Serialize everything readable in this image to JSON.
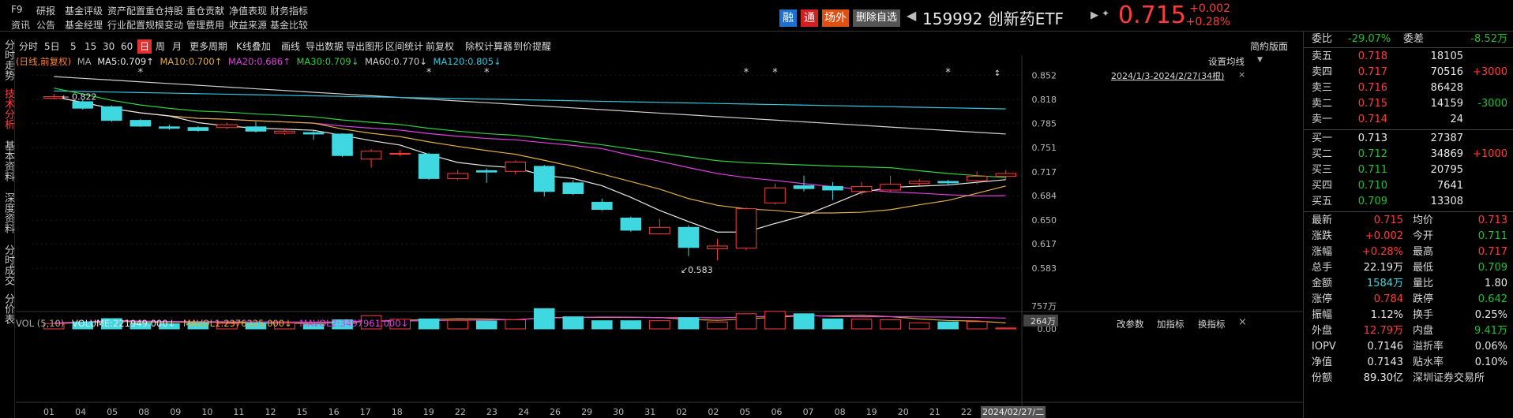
{
  "menu": {
    "code_key": "F9",
    "row1": [
      "研报",
      "基金评级",
      "资产配置",
      "重仓持股",
      "重仓贡献",
      "净值表现",
      "财务指标"
    ],
    "row2": [
      "资讯",
      "公告",
      "基金经理",
      "行业配置",
      "规模变动",
      "管理费用",
      "收益来源",
      "基金比较"
    ]
  },
  "header": {
    "btn_rong": "融",
    "btn_tong": "通",
    "btn_changwai": "场外",
    "btn_delete": "删除自选",
    "title": "159992 创新药ETF",
    "price": "0.715",
    "change": "+0.002",
    "change_pct": "+0.28%"
  },
  "left_tabs": [
    "分时走势",
    "技术分析",
    "基本资料",
    "深度资料",
    "分时成交",
    "分价表"
  ],
  "toolbar": {
    "items": [
      "分时",
      "5日",
      "5",
      "15",
      "30",
      "60",
      "日",
      "周",
      "月",
      "更多周期",
      "K线叠加",
      "画线",
      "导出数据",
      "导出图形",
      "区间统计",
      "前复权",
      "除权计算器",
      "到价提醒"
    ],
    "active": "日",
    "right_label": "简約版面"
  },
  "ma_row": {
    "prefix": "(日线,前复权)",
    "ma_label": "MA",
    "ma5": "MA5:0.709↑",
    "ma10": "MA10:0.700↑",
    "ma20": "MA20:0.686↑",
    "ma30": "MA30:0.709↓",
    "ma60": "MA60:0.770↓",
    "ma120": "MA120:0.805↓"
  },
  "chart_meta": {
    "set_ma": "设置均线",
    "range_label": "2024/1/3-2024/2/27(34根)",
    "high_label": "0.822",
    "low_label": "0.583"
  },
  "vol_row": {
    "label": "VOL (5,10)",
    "volume": "VOLUME:221949.000↓",
    "mavol1": "MAVOL1:2376325.000↓",
    "mavol2": "MAVOL2:3497961.000↓",
    "btn_params": "改参数",
    "btn_add": "加指标",
    "btn_switch": "换指标"
  },
  "colors": {
    "up": "#ff3b3b",
    "down": "#3fd8e0",
    "ma5": "#e8e8e8",
    "ma10": "#e0b040",
    "ma20": "#e040e0",
    "ma30": "#30d040",
    "ma60": "#d0d0d0",
    "ma120": "#30c8e0"
  },
  "chart_data": {
    "type": "candlestick",
    "price_ticks": [
      "0.852",
      "0.818",
      "0.785",
      "0.751",
      "0.717",
      "0.684",
      "0.650",
      "0.617",
      "0.583"
    ],
    "ylim": [
      0.57,
      0.86
    ],
    "vol_ticks": [
      "757万",
      "264万",
      "0.00"
    ],
    "vol_ylim": [
      0,
      757
    ],
    "vol_current_label": "264万",
    "x_labels": [
      "01",
      "04",
      "05",
      "08",
      "09",
      "10",
      "11",
      "12",
      "15",
      "16",
      "17",
      "18",
      "19",
      "22",
      "23",
      "24",
      "26",
      "29",
      "30",
      "31",
      "02",
      "02",
      "05",
      "06",
      "07",
      "08",
      "19",
      "20",
      "21",
      "22",
      "2"
    ],
    "date_cursor": "2024/02/27/二",
    "candles": [
      {
        "o": 0.82,
        "c": 0.822,
        "h": 0.826,
        "l": 0.818,
        "v": 180
      },
      {
        "o": 0.815,
        "c": 0.806,
        "h": 0.818,
        "l": 0.804,
        "v": 230
      },
      {
        "o": 0.808,
        "c": 0.789,
        "h": 0.81,
        "l": 0.787,
        "v": 340
      },
      {
        "o": 0.789,
        "c": 0.781,
        "h": 0.791,
        "l": 0.78,
        "v": 190
      },
      {
        "o": 0.78,
        "c": 0.778,
        "h": 0.783,
        "l": 0.776,
        "v": 170
      },
      {
        "o": 0.779,
        "c": 0.775,
        "h": 0.781,
        "l": 0.773,
        "v": 200
      },
      {
        "o": 0.779,
        "c": 0.783,
        "h": 0.786,
        "l": 0.777,
        "v": 180
      },
      {
        "o": 0.78,
        "c": 0.774,
        "h": 0.787,
        "l": 0.772,
        "v": 200
      },
      {
        "o": 0.771,
        "c": 0.774,
        "h": 0.778,
        "l": 0.769,
        "v": 190
      },
      {
        "o": 0.772,
        "c": 0.77,
        "h": 0.775,
        "l": 0.762,
        "v": 150
      },
      {
        "o": 0.77,
        "c": 0.74,
        "h": 0.771,
        "l": 0.738,
        "v": 300
      },
      {
        "o": 0.735,
        "c": 0.746,
        "h": 0.749,
        "l": 0.723,
        "v": 440
      },
      {
        "o": 0.742,
        "c": 0.743,
        "h": 0.748,
        "l": 0.739,
        "v": 320
      },
      {
        "o": 0.742,
        "c": 0.708,
        "h": 0.744,
        "l": 0.706,
        "v": 330
      },
      {
        "o": 0.708,
        "c": 0.715,
        "h": 0.72,
        "l": 0.706,
        "v": 280
      },
      {
        "o": 0.719,
        "c": 0.717,
        "h": 0.722,
        "l": 0.702,
        "v": 260
      },
      {
        "o": 0.718,
        "c": 0.731,
        "h": 0.733,
        "l": 0.714,
        "v": 300
      },
      {
        "o": 0.725,
        "c": 0.69,
        "h": 0.727,
        "l": 0.683,
        "v": 670
      },
      {
        "o": 0.702,
        "c": 0.687,
        "h": 0.706,
        "l": 0.685,
        "v": 400
      },
      {
        "o": 0.675,
        "c": 0.665,
        "h": 0.68,
        "l": 0.663,
        "v": 270
      },
      {
        "o": 0.653,
        "c": 0.636,
        "h": 0.655,
        "l": 0.634,
        "v": 270
      },
      {
        "o": 0.631,
        "c": 0.64,
        "h": 0.652,
        "l": 0.63,
        "v": 270
      },
      {
        "o": 0.64,
        "c": 0.612,
        "h": 0.643,
        "l": 0.6,
        "v": 370
      },
      {
        "o": 0.61,
        "c": 0.614,
        "h": 0.624,
        "l": 0.594,
        "v": 230
      },
      {
        "o": 0.611,
        "c": 0.666,
        "h": 0.668,
        "l": 0.608,
        "v": 500
      },
      {
        "o": 0.674,
        "c": 0.695,
        "h": 0.701,
        "l": 0.672,
        "v": 580
      },
      {
        "o": 0.698,
        "c": 0.694,
        "h": 0.712,
        "l": 0.69,
        "v": 500
      },
      {
        "o": 0.697,
        "c": 0.692,
        "h": 0.703,
        "l": 0.678,
        "v": 330
      },
      {
        "o": 0.69,
        "c": 0.697,
        "h": 0.703,
        "l": 0.685,
        "v": 320
      },
      {
        "o": 0.692,
        "c": 0.7,
        "h": 0.712,
        "l": 0.69,
        "v": 300
      },
      {
        "o": 0.701,
        "c": 0.704,
        "h": 0.707,
        "l": 0.698,
        "v": 200
      },
      {
        "o": 0.704,
        "c": 0.702,
        "h": 0.706,
        "l": 0.699,
        "v": 230
      },
      {
        "o": 0.705,
        "c": 0.711,
        "h": 0.718,
        "l": 0.7,
        "v": 240
      },
      {
        "o": 0.711,
        "c": 0.715,
        "h": 0.72,
        "l": 0.707,
        "v": 30
      }
    ]
  },
  "quote": {
    "weibi_label": "委比",
    "weibi": "-29.07%",
    "weicha_label": "委差",
    "weicha": "-8.52万",
    "sell": [
      {
        "label": "卖五",
        "price": "0.718",
        "vol": "18105",
        "chg": ""
      },
      {
        "label": "卖四",
        "price": "0.717",
        "vol": "70516",
        "chg": "+3000"
      },
      {
        "label": "卖三",
        "price": "0.716",
        "vol": "86428",
        "chg": ""
      },
      {
        "label": "卖二",
        "price": "0.715",
        "vol": "14159",
        "chg": "-3000"
      },
      {
        "label": "卖一",
        "price": "0.714",
        "vol": "24",
        "chg": ""
      }
    ],
    "buy": [
      {
        "label": "买一",
        "price": "0.713",
        "vol": "27387",
        "chg": ""
      },
      {
        "label": "买二",
        "price": "0.712",
        "vol": "34869",
        "chg": "+1000"
      },
      {
        "label": "买三",
        "price": "0.711",
        "vol": "20795",
        "chg": ""
      },
      {
        "label": "买四",
        "price": "0.710",
        "vol": "7641",
        "chg": ""
      },
      {
        "label": "买五",
        "price": "0.709",
        "vol": "13308",
        "chg": ""
      }
    ],
    "stats": [
      {
        "l1": "最新",
        "v1": "0.715",
        "c1": "red",
        "l2": "均价",
        "v2": "0.713",
        "c2": "red"
      },
      {
        "l1": "涨跌",
        "v1": "+0.002",
        "c1": "red",
        "l2": "今开",
        "v2": "0.711",
        "c2": "green"
      },
      {
        "l1": "涨幅",
        "v1": "+0.28%",
        "c1": "red",
        "l2": "最高",
        "v2": "0.717",
        "c2": "red"
      },
      {
        "l1": "总手",
        "v1": "22.19万",
        "c1": "white",
        "l2": "最低",
        "v2": "0.709",
        "c2": "green"
      },
      {
        "l1": "金额",
        "v1": "1584万",
        "c1": "cyan",
        "l2": "量比",
        "v2": "1.80",
        "c2": "white"
      },
      {
        "l1": "涨停",
        "v1": "0.784",
        "c1": "red",
        "l2": "跌停",
        "v2": "0.642",
        "c2": "green"
      },
      {
        "l1": "振幅",
        "v1": "1.12%",
        "c1": "white",
        "l2": "换手",
        "v2": "0.25%",
        "c2": "white"
      },
      {
        "l1": "外盘",
        "v1": "12.79万",
        "c1": "red",
        "l2": "内盘",
        "v2": "9.41万",
        "c2": "green"
      },
      {
        "l1": "IOPV",
        "v1": "0.7146",
        "c1": "white",
        "l2": "溢折率",
        "v2": "0.06%",
        "c2": "white"
      },
      {
        "l1": "净值",
        "v1": "0.7143",
        "c1": "white",
        "l2": "贴水率",
        "v2": "0.10%",
        "c2": "white"
      },
      {
        "l1": "份额",
        "v1": "89.30亿",
        "c1": "white",
        "l2": "深圳证券交易所",
        "v2": "",
        "c2": "white"
      }
    ]
  }
}
